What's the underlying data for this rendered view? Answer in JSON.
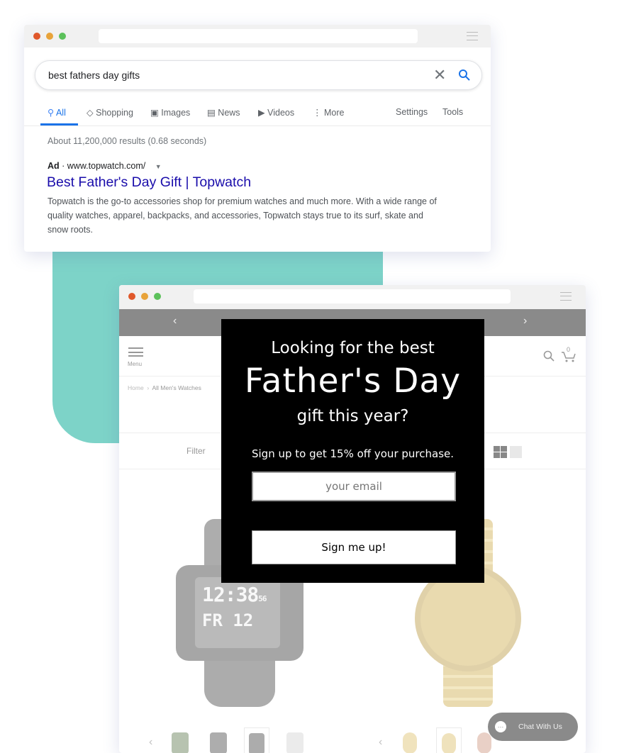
{
  "search_window": {
    "query": "best fathers day gifts",
    "tabs": [
      {
        "label": "All",
        "icon": "search-icon",
        "active": true
      },
      {
        "label": "Shopping",
        "icon": "tag-icon"
      },
      {
        "label": "Images",
        "icon": "image-icon"
      },
      {
        "label": "News",
        "icon": "news-icon"
      },
      {
        "label": "Videos",
        "icon": "play-icon"
      },
      {
        "label": "More",
        "icon": "more-vertical-icon"
      }
    ],
    "settings": "Settings",
    "tools": "Tools",
    "results_count": "About 11,200,000 results (0.68 seconds)",
    "ad": {
      "label": "Ad",
      "url": "www.topwatch.com/",
      "title": "Best Father's Day Gift | Topwatch",
      "description": "Topwatch is the go-to accessories shop for premium watches and much more. With a wide range of quality watches, apparel, backpacks, and accessories, Topwatch stays true to its surf, skate and snow roots."
    },
    "colors": {
      "link": "#1a0dab",
      "accent": "#1a73e8"
    }
  },
  "shop_window": {
    "menu_label": "Menu",
    "cart_count": "0",
    "breadcrumb": [
      "Home",
      "All Men's Watches"
    ],
    "filter_label": "Filter",
    "chat_label": "Chat With Us"
  },
  "popup": {
    "line1": "Looking for the best",
    "line2": "Father's Day",
    "line3": "gift this year?",
    "offer": "Sign up to get 15% off your purchase.",
    "email_placeholder": "your email",
    "submit": "Sign me up!"
  },
  "watch_display": {
    "time": "12:38",
    "seconds": "56",
    "date": "FR 12"
  }
}
